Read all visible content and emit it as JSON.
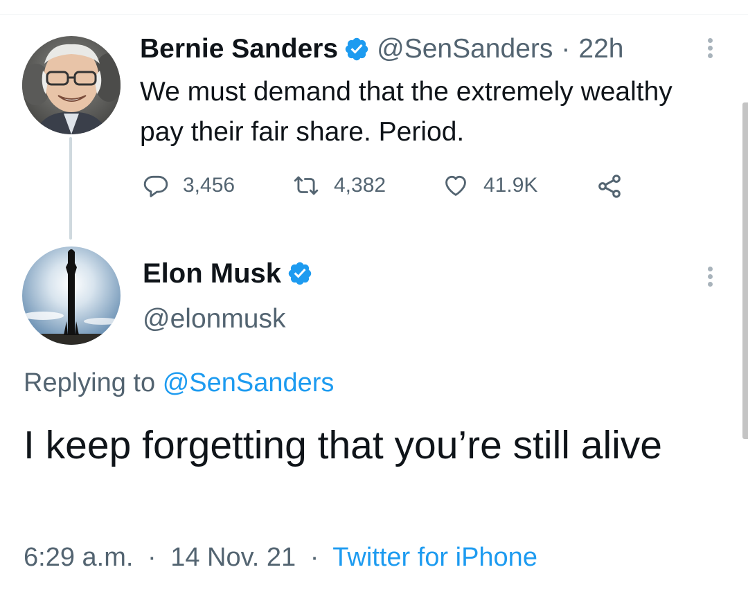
{
  "parent_tweet": {
    "display_name": "Bernie Sanders",
    "handle": "@SenSanders",
    "separator": "·",
    "time": "22h",
    "text": "We must demand that the extremely wealthy pay their fair share. Period.",
    "replies": "3,456",
    "retweets": "4,382",
    "likes": "41.9K",
    "avatar_icon": "portrait-avatar",
    "verified_icon": "verified-badge-icon"
  },
  "reply_tweet": {
    "display_name": "Elon Musk",
    "handle": "@elonmusk",
    "replying_prefix": "Replying to",
    "replying_to": "@SenSanders",
    "text": "I keep forgetting that you’re still alive",
    "time": "6:29 a.m.",
    "date": "14 Nov. 21",
    "separator": "·",
    "source": "Twitter for iPhone",
    "avatar_icon": "rocket-avatar",
    "verified_icon": "verified-badge-icon"
  },
  "colors": {
    "text_primary": "#0f1419",
    "text_secondary": "#536471",
    "accent": "#1d9bf0",
    "thread_line": "#cfd9de"
  },
  "icons": {
    "reply": "reply-icon",
    "retweet": "retweet-icon",
    "like": "heart-icon",
    "share": "share-icon",
    "more": "more-icon"
  }
}
